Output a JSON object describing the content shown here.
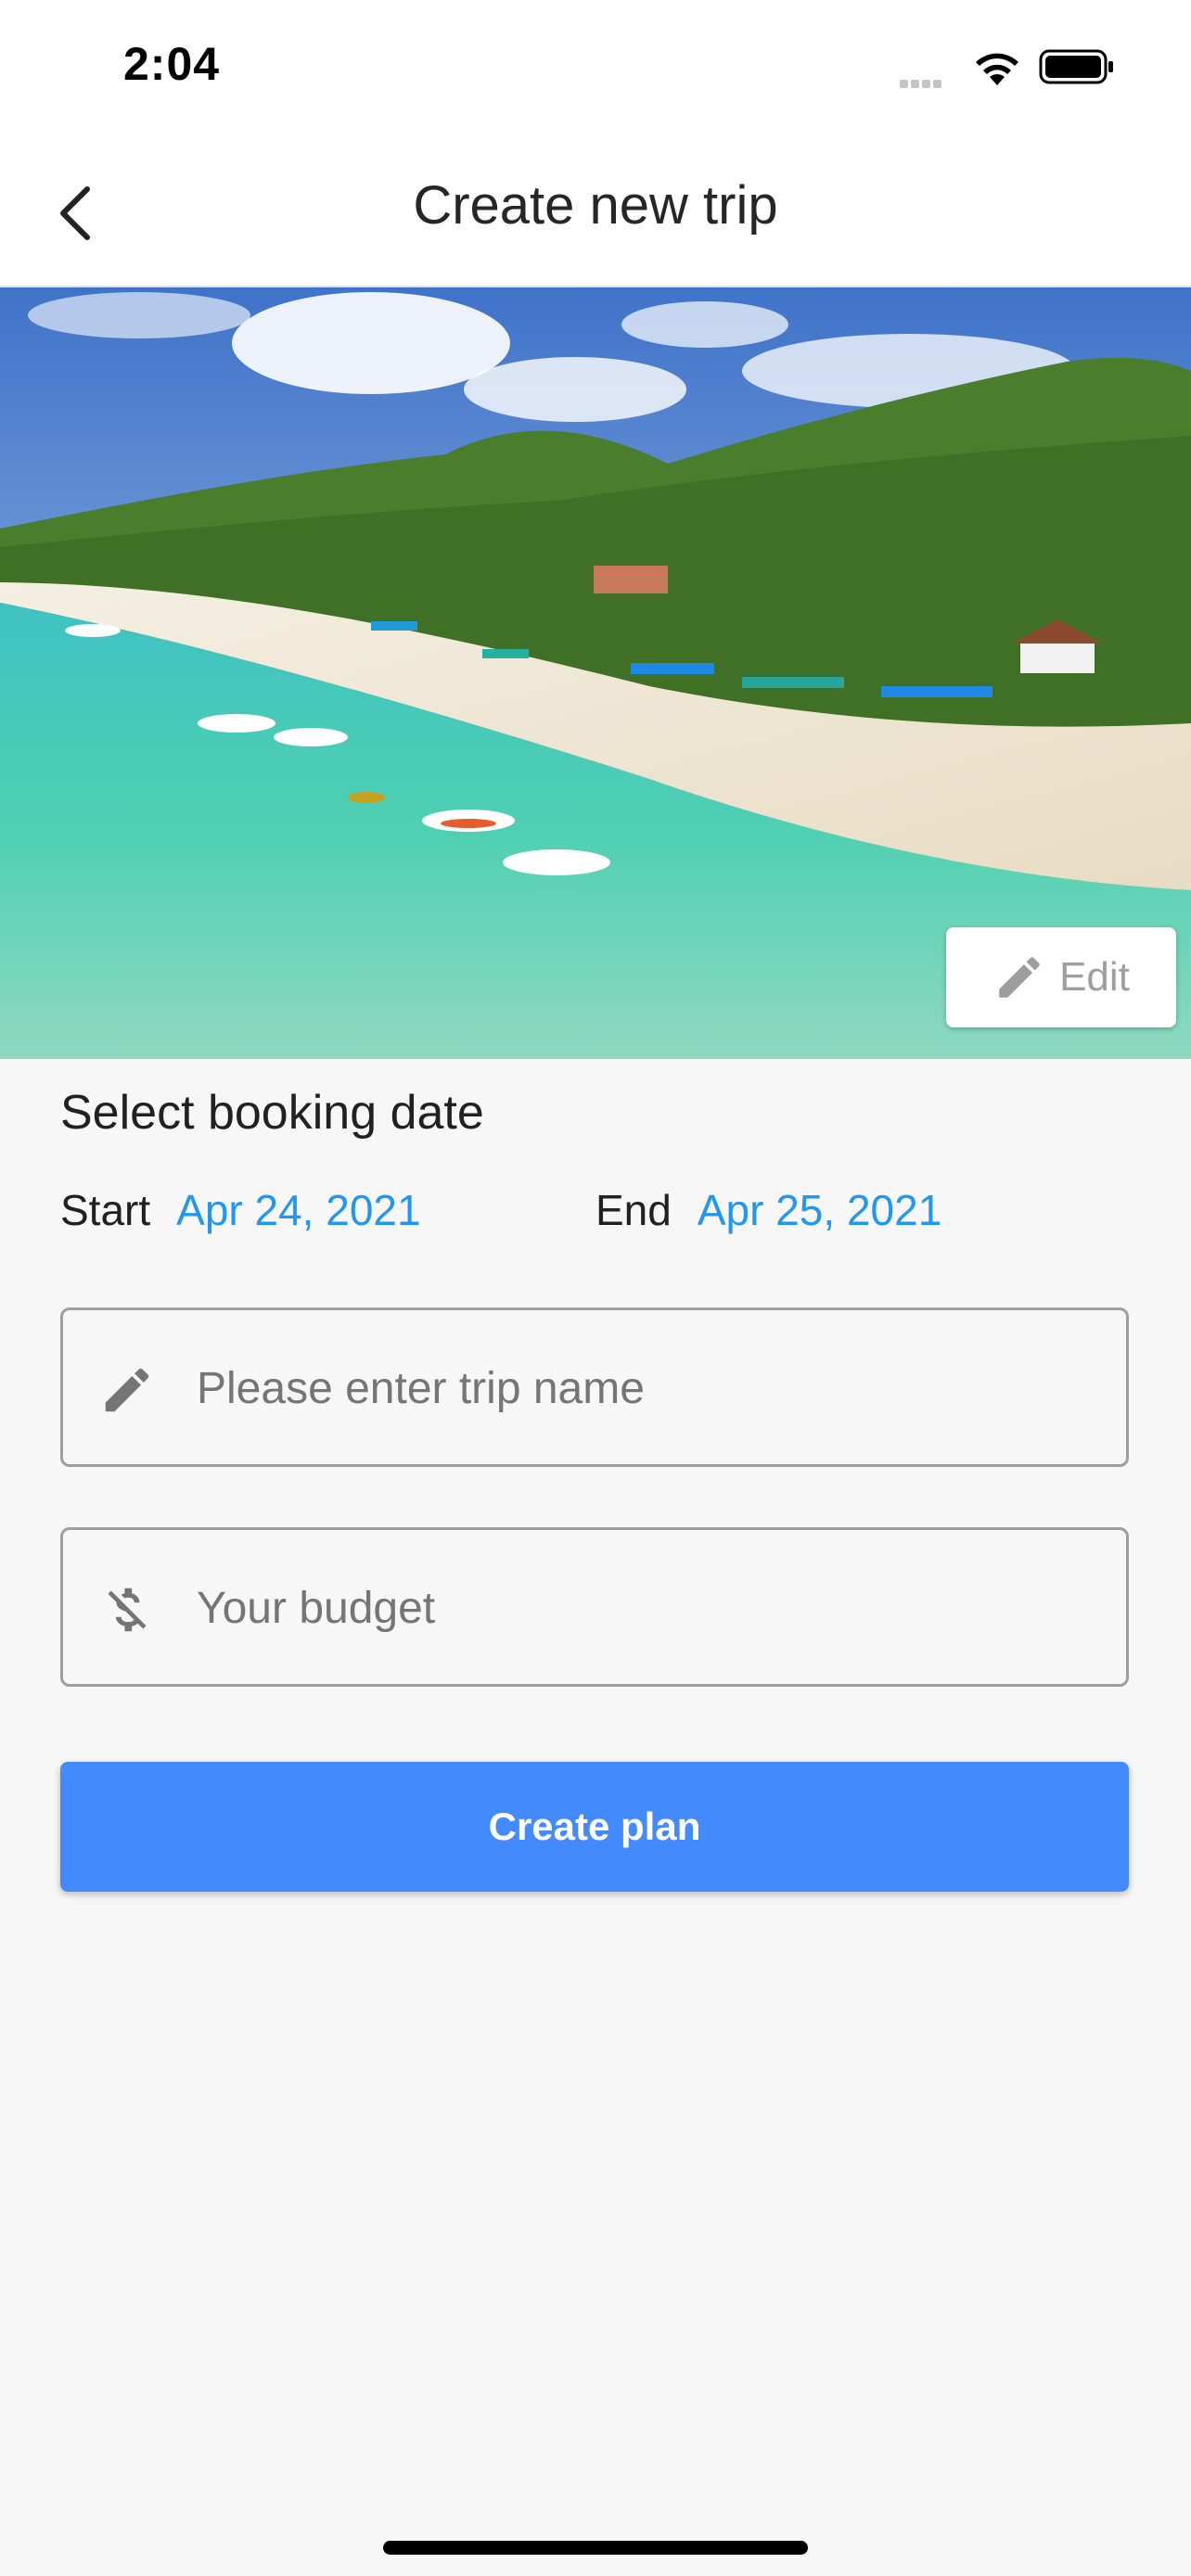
{
  "status_bar": {
    "time": "2:04",
    "icons": [
      "cellular-signal-icon",
      "wifi-icon",
      "battery-icon"
    ]
  },
  "app_bar": {
    "back_icon": "chevron-left-icon",
    "title": "Create new trip"
  },
  "hero": {
    "edit_icon": "pencil-icon",
    "edit_label": "Edit"
  },
  "booking": {
    "title": "Select booking date",
    "start_label": "Start",
    "start_date": "Apr 24, 2021",
    "end_label": "End",
    "end_date": "Apr 25, 2021"
  },
  "trip_name": {
    "icon": "pencil-icon",
    "value": "",
    "placeholder": "Please enter trip name"
  },
  "budget": {
    "icon": "no-money-icon",
    "value": "",
    "placeholder": "Your budget"
  },
  "create_button": {
    "label": "Create plan"
  },
  "colors": {
    "accent": "#448aff",
    "date_link": "#2196f3"
  }
}
